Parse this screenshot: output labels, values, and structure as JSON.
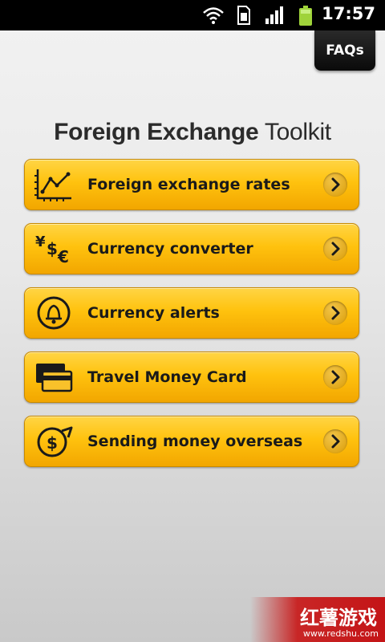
{
  "status_bar": {
    "time": "17:57",
    "icons": [
      "wifi-icon",
      "sim-card-icon",
      "signal-icon",
      "battery-icon"
    ]
  },
  "header": {
    "faqs_label": "FAQs"
  },
  "title": {
    "bold_part": "Foreign Exchange",
    "light_part": "Toolkit"
  },
  "menu": {
    "items": [
      {
        "label": "Foreign exchange rates",
        "icon": "chart-icon"
      },
      {
        "label": "Currency converter",
        "icon": "currency-symbols-icon"
      },
      {
        "label": "Currency alerts",
        "icon": "bell-icon"
      },
      {
        "label": "Travel Money Card",
        "icon": "card-icon"
      },
      {
        "label": "Sending money overseas",
        "icon": "dollar-send-icon"
      }
    ]
  },
  "watermark": {
    "text": "红薯游戏",
    "url": "www.redshu.com"
  },
  "colors": {
    "button_yellow": "#ffc20e",
    "status_bar": "#000000",
    "battery_green": "#9fd33a"
  }
}
